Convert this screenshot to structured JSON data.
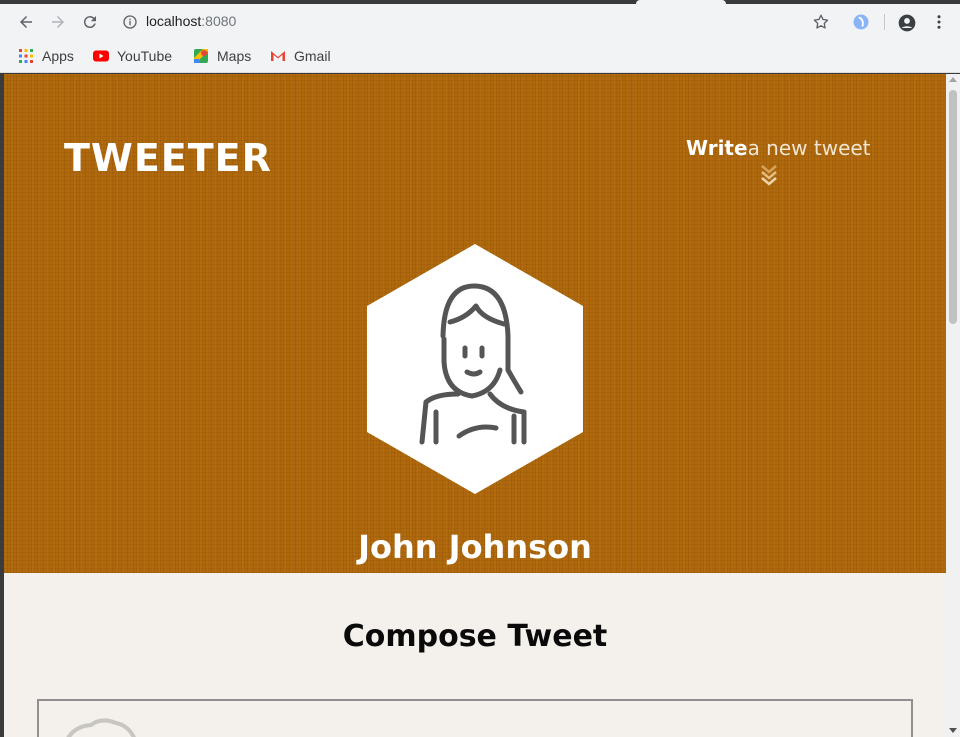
{
  "browser": {
    "url_host": "localhost",
    "url_port": ":8080",
    "bookmarks": [
      {
        "label": "Apps",
        "icon": "apps-grid-icon"
      },
      {
        "label": "YouTube",
        "icon": "youtube-icon"
      },
      {
        "label": "Maps",
        "icon": "maps-icon"
      },
      {
        "label": "Gmail",
        "icon": "gmail-icon"
      }
    ]
  },
  "header": {
    "logo": "TWEETER",
    "write_bold": "Write",
    "write_rest": "a new tweet"
  },
  "profile": {
    "name": "John Johnson"
  },
  "compose": {
    "title": "Compose Tweet"
  },
  "colors": {
    "hero": "#b0680b",
    "page_bg": "#f4f1ec",
    "text_dark": "#0a0a0a"
  }
}
